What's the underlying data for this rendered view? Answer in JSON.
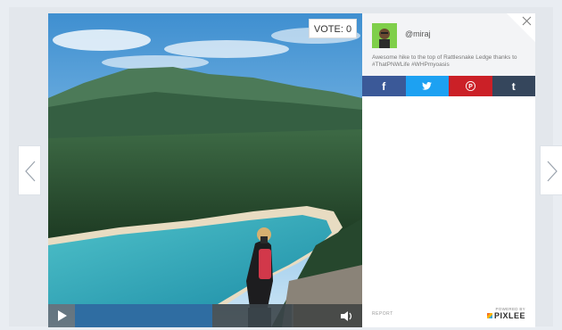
{
  "lightbox": {
    "vote_label": "VOTE: 0",
    "handle": "@miraj",
    "caption": "Awesome hike to the top of Rattlesnake Ledge thanks to #ThatPNWLife #WHPmyoasis",
    "report_label": "REPORT",
    "powered_by_label": "POWERED BY",
    "brand_label": "PIXLEE"
  },
  "share": {
    "facebook_label": "f",
    "twitter_label": "🐦",
    "pinterest_label": "P",
    "tumblr_label": "t",
    "colors": {
      "facebook": "#3b5998",
      "twitter": "#1da1f2",
      "pinterest": "#cb2027",
      "tumblr": "#35465c"
    }
  },
  "video": {
    "progress_fraction": 0.63,
    "buffer_fraction": 0.36
  },
  "icons": [
    "close-icon",
    "play-icon",
    "volume-icon",
    "chevron-left-icon",
    "chevron-right-icon"
  ]
}
